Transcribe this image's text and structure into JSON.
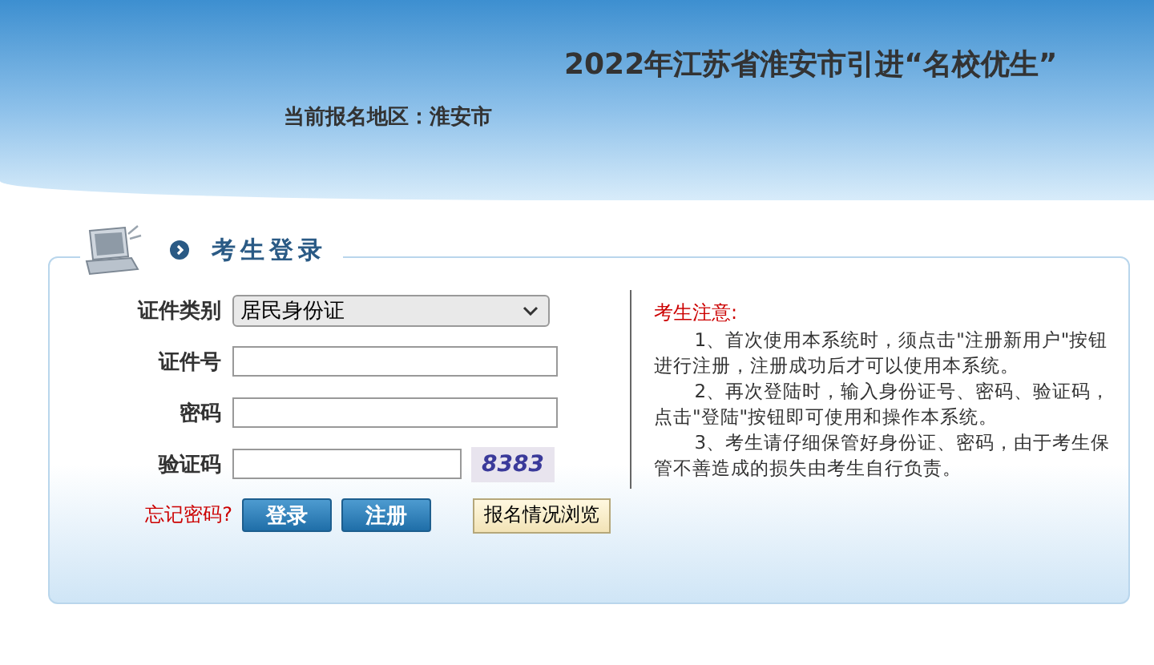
{
  "header": {
    "title": "2022年江苏省淮安市引进“名校优生”",
    "region": "当前报名地区：淮安市"
  },
  "login": {
    "title": "考生登录",
    "fields": [
      {
        "kind": "select",
        "label": "证件类别",
        "value": "居民身份证"
      },
      {
        "kind": "text",
        "label": "证件号"
      },
      {
        "kind": "password",
        "label": "密码"
      },
      {
        "kind": "captcha",
        "label": "验证码",
        "captcha": "8383"
      }
    ],
    "forgot": "忘记密码?",
    "buttons": [
      "登录",
      "注册"
    ],
    "browse": "报名情况浏览"
  },
  "notice": {
    "title": "考生注意:",
    "items": [
      "1、首次使用本系统时，须点击\"注册新用户\"按钮进行注册，注册成功后才可以使用本系统。",
      "2、再次登陆时，输入身份证号、密码、验证码，点击\"登陆\"按钮即可使用和操作本系统。",
      "3、考生请仔细保管好身份证、密码，由于考生保管不善造成的损失由考生自行负责。"
    ]
  }
}
